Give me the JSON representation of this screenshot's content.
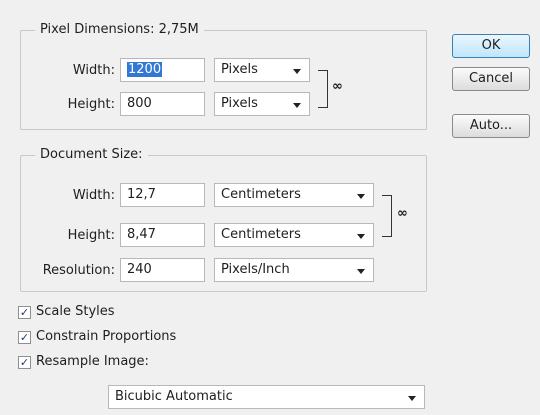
{
  "pixel_dimensions": {
    "legend": "Pixel Dimensions:  2,75M",
    "width_label": "Width:",
    "width_value": "1200",
    "width_unit": "Pixels",
    "height_label": "Height:",
    "height_value": "800",
    "height_unit": "Pixels"
  },
  "document_size": {
    "legend": "Document Size:",
    "width_label": "Width:",
    "width_value": "12,7",
    "width_unit": "Centimeters",
    "height_label": "Height:",
    "height_value": "8,47",
    "height_unit": "Centimeters",
    "resolution_label": "Resolution:",
    "resolution_value": "240",
    "resolution_unit": "Pixels/Inch"
  },
  "buttons": {
    "ok": "OK",
    "cancel": "Cancel",
    "auto": "Auto..."
  },
  "options": {
    "scale_styles": {
      "label": "Scale Styles",
      "checked": true
    },
    "constrain_proportions": {
      "label": "Constrain Proportions",
      "checked": true
    },
    "resample_image": {
      "label": "Resample Image:",
      "checked": true
    },
    "resample_method": "Bicubic Automatic"
  },
  "icons": {
    "chain_link": "chain-link-icon",
    "dropdown": "chevron-down-icon",
    "checkmark": "checkmark-icon"
  },
  "colors": {
    "dialog_bg": "#f0f0f0",
    "selection": "#3478d6",
    "default_button_border": "#3c7fb1"
  }
}
